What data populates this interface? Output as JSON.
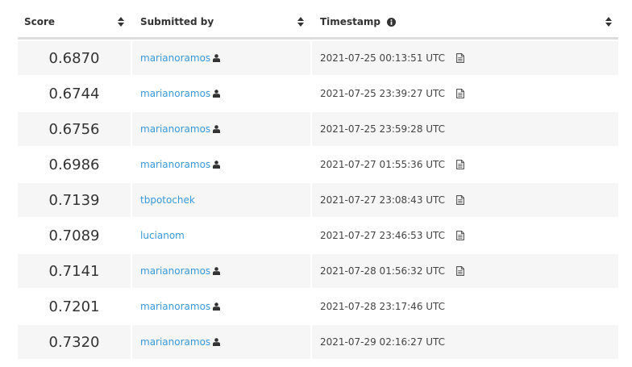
{
  "header": {
    "score_label": "Score",
    "submitted_by_label": "Submitted by",
    "timestamp_label": "Timestamp"
  },
  "rows": [
    {
      "score": "0.6870",
      "user": "marianoramos",
      "timestamp": "2021-07-25 00:13:51 UTC",
      "owner": true,
      "doc": true
    },
    {
      "score": "0.6744",
      "user": "marianoramos",
      "timestamp": "2021-07-25 23:39:27 UTC",
      "owner": true,
      "doc": true
    },
    {
      "score": "0.6756",
      "user": "marianoramos",
      "timestamp": "2021-07-25 23:59:28 UTC",
      "owner": true,
      "doc": false
    },
    {
      "score": "0.6986",
      "user": "marianoramos",
      "timestamp": "2021-07-27 01:55:36 UTC",
      "owner": true,
      "doc": true
    },
    {
      "score": "0.7139",
      "user": "tbpotochek",
      "timestamp": "2021-07-27 23:08:43 UTC",
      "owner": false,
      "doc": true
    },
    {
      "score": "0.7089",
      "user": "lucianom",
      "timestamp": "2021-07-27 23:46:53 UTC",
      "owner": false,
      "doc": true
    },
    {
      "score": "0.7141",
      "user": "marianoramos",
      "timestamp": "2021-07-28 01:56:32 UTC",
      "owner": true,
      "doc": true
    },
    {
      "score": "0.7201",
      "user": "marianoramos",
      "timestamp": "2021-07-28 23:17:46 UTC",
      "owner": true,
      "doc": false
    },
    {
      "score": "0.7320",
      "user": "marianoramos",
      "timestamp": "2021-07-29 02:16:27 UTC",
      "owner": true,
      "doc": false
    }
  ],
  "icons": {
    "sort": "sort-icon",
    "info": "info-icon",
    "owner": "person-icon",
    "doc": "document-icon"
  },
  "colors": {
    "link": "#3a99d8",
    "row_stripe": "#f6f6f6",
    "header_border": "#dddddd"
  }
}
